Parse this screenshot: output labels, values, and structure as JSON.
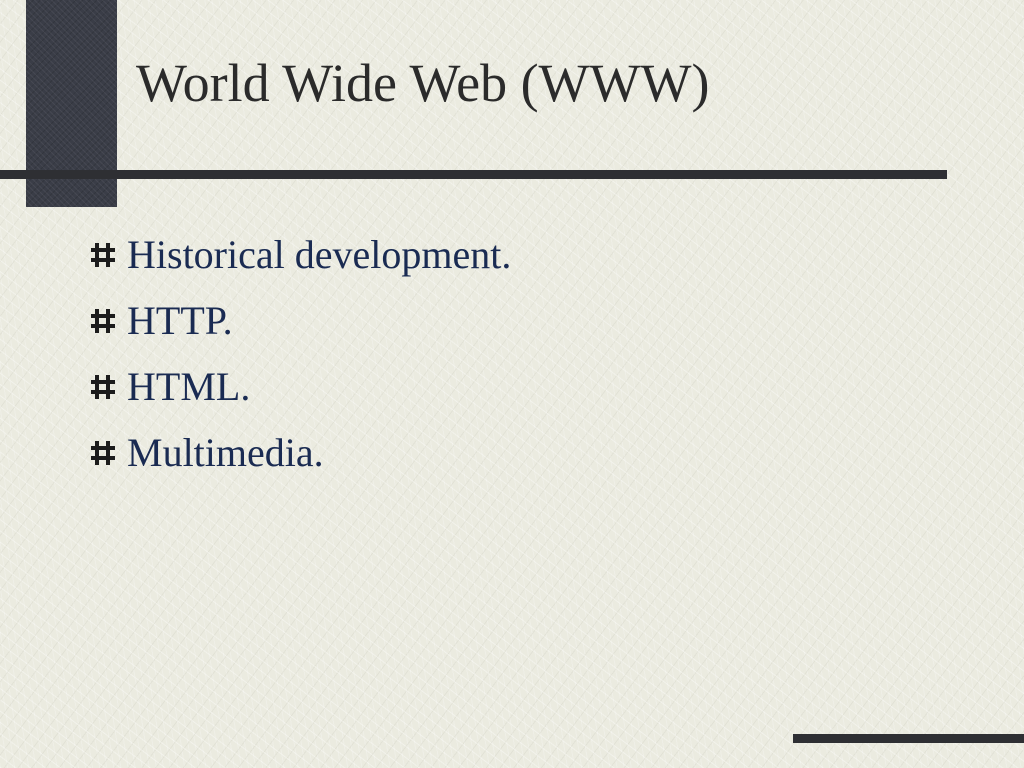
{
  "slide": {
    "title": "World Wide Web (WWW)",
    "bullets": [
      {
        "text": "Historical development.",
        "icon": "hash-bullet-icon"
      },
      {
        "text": "HTTP.",
        "icon": "hash-bullet-icon"
      },
      {
        "text": "HTML.",
        "icon": "hash-bullet-icon"
      },
      {
        "text": "Multimedia.",
        "icon": "hash-bullet-icon"
      }
    ]
  },
  "colors": {
    "background": "#ebebe0",
    "accent_dark": "#3a3d47",
    "rule": "#2e2f33",
    "title_text": "#2b2b2b",
    "bullet_text": "#1a2b52"
  }
}
